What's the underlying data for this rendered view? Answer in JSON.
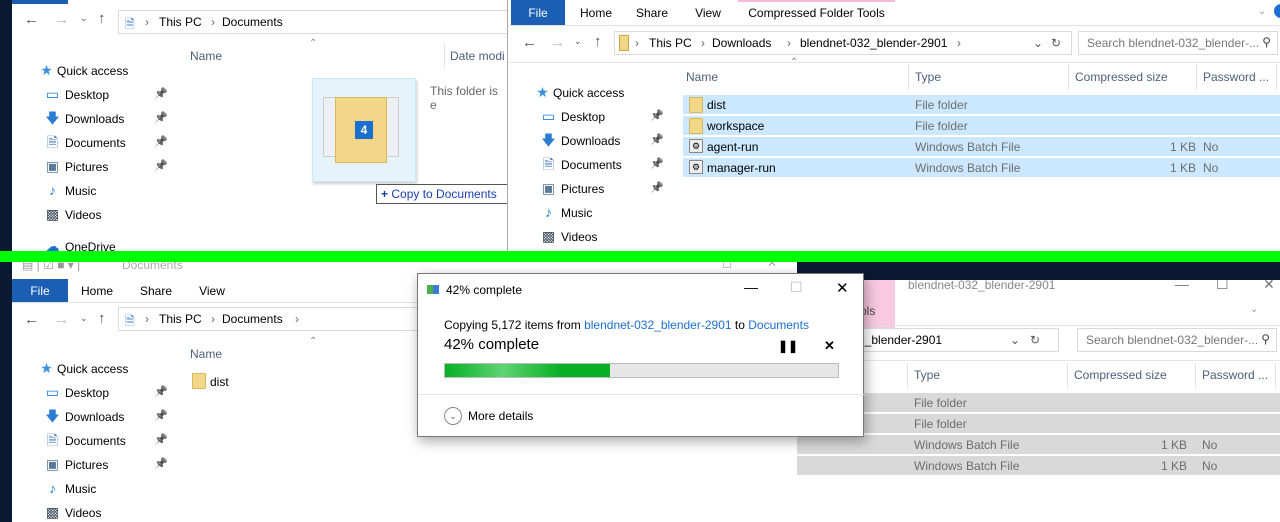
{
  "colors": {
    "accent": "#1a5fb4",
    "selection": "#cce8ff",
    "progress": "#06b025",
    "separator": "#00ff00"
  },
  "top_left": {
    "address": [
      "This PC",
      "Documents"
    ],
    "columns": {
      "name": "Name",
      "date": "Date modi"
    },
    "empty_text": "This folder is e",
    "drag_count": "4",
    "drop_tooltip": "Copy to Documents",
    "sidebar": [
      {
        "label": "Quick access",
        "icon": "star-icon",
        "pinned": false
      },
      {
        "label": "Desktop",
        "icon": "desktop-icon",
        "pinned": true
      },
      {
        "label": "Downloads",
        "icon": "download-icon",
        "pinned": true
      },
      {
        "label": "Documents",
        "icon": "document-icon",
        "pinned": true
      },
      {
        "label": "Pictures",
        "icon": "pictures-icon",
        "pinned": true
      },
      {
        "label": "Music",
        "icon": "music-icon",
        "pinned": false
      },
      {
        "label": "Videos",
        "icon": "videos-icon",
        "pinned": false
      },
      {
        "label": "OneDrive",
        "icon": "cloud-icon",
        "pinned": false
      }
    ]
  },
  "top_right": {
    "tabs": [
      "File",
      "Home",
      "Share",
      "View",
      "Compressed Folder Tools"
    ],
    "address": [
      "This PC",
      "Downloads",
      "blendnet-032_blender-2901"
    ],
    "search_placeholder": "Search blendnet-032_blender-...",
    "columns": [
      "Name",
      "Type",
      "Compressed size",
      "Password ..."
    ],
    "rows": [
      {
        "name": "dist",
        "type": "File folder",
        "size": "",
        "password": "",
        "kind": "folder"
      },
      {
        "name": "workspace",
        "type": "File folder",
        "size": "",
        "password": "",
        "kind": "folder"
      },
      {
        "name": "agent-run",
        "type": "Windows Batch File",
        "size": "1 KB",
        "password": "No",
        "kind": "batch"
      },
      {
        "name": "manager-run",
        "type": "Windows Batch File",
        "size": "1 KB",
        "password": "No",
        "kind": "batch"
      }
    ],
    "sidebar": [
      {
        "label": "Quick access",
        "icon": "star-icon",
        "pinned": false
      },
      {
        "label": "Desktop",
        "icon": "desktop-icon",
        "pinned": true
      },
      {
        "label": "Downloads",
        "icon": "download-icon",
        "pinned": true
      },
      {
        "label": "Documents",
        "icon": "document-icon",
        "pinned": true
      },
      {
        "label": "Pictures",
        "icon": "pictures-icon",
        "pinned": true
      },
      {
        "label": "Music",
        "icon": "music-icon",
        "pinned": false
      },
      {
        "label": "Videos",
        "icon": "videos-icon",
        "pinned": false
      }
    ]
  },
  "bottom_left": {
    "title": "Documents",
    "tabs": [
      "File",
      "Home",
      "Share",
      "View"
    ],
    "address": [
      "This PC",
      "Documents"
    ],
    "columns": {
      "name": "Name"
    },
    "items": [
      "dist"
    ],
    "sidebar": [
      {
        "label": "Quick access",
        "icon": "star-icon",
        "pinned": false
      },
      {
        "label": "Desktop",
        "icon": "desktop-icon",
        "pinned": true
      },
      {
        "label": "Downloads",
        "icon": "download-icon",
        "pinned": true
      },
      {
        "label": "Documents",
        "icon": "document-icon",
        "pinned": true
      },
      {
        "label": "Pictures",
        "icon": "pictures-icon",
        "pinned": true
      },
      {
        "label": "Music",
        "icon": "music-icon",
        "pinned": false
      },
      {
        "label": "Videos",
        "icon": "videos-icon",
        "pinned": false
      }
    ]
  },
  "bottom_right": {
    "title": "blendnet-032_blender-2901",
    "tab_partial": "ols",
    "address_partial": "2_blender-2901",
    "search_placeholder": "Search blendnet-032_blender-...",
    "columns": [
      "Type",
      "Compressed size",
      "Password ..."
    ],
    "rows": [
      {
        "type": "File folder",
        "size": "",
        "password": ""
      },
      {
        "type": "File folder",
        "size": "",
        "password": ""
      },
      {
        "type": "Windows Batch File",
        "size": "1 KB",
        "password": "No"
      },
      {
        "type": "Windows Batch File",
        "size": "1 KB",
        "password": "No"
      }
    ]
  },
  "dialog": {
    "title": "42% complete",
    "copy_prefix": "Copying 5,172 items from",
    "source": "blendnet-032_blender-2901",
    "to": "to",
    "destination": "Documents",
    "status": "42% complete",
    "progress_percent": 42,
    "more_details": "More details"
  }
}
